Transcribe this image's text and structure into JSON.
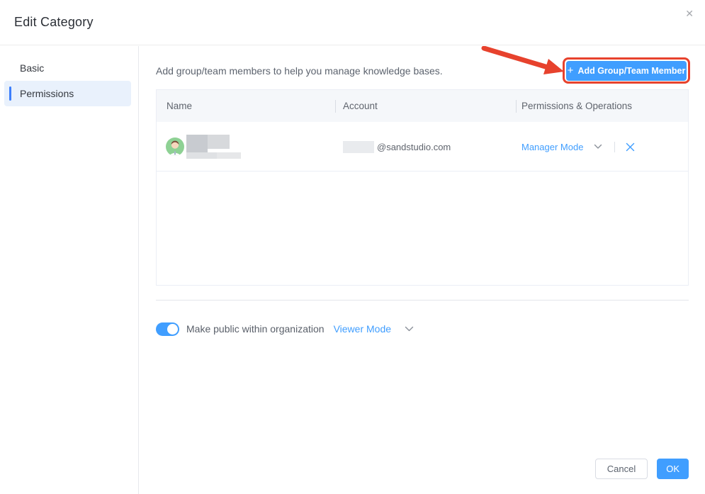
{
  "dialog": {
    "title": "Edit Category"
  },
  "icons": {
    "close": "✕",
    "plus": "+",
    "chevron_down": "v-shape",
    "remove": "x-shape"
  },
  "sidebar": {
    "items": [
      {
        "label": "Basic",
        "active": false
      },
      {
        "label": "Permissions",
        "active": true
      }
    ]
  },
  "permissions_panel": {
    "description": "Add group/team members to help you manage knowledge bases.",
    "add_member_button": "Add Group/Team Member",
    "table": {
      "columns": [
        "Name",
        "Account",
        "Permissions & Operations"
      ],
      "rows": [
        {
          "name_redacted": true,
          "account_prefix_redacted": true,
          "account": "@sandstudio.com",
          "permission_mode": "Manager Mode"
        }
      ]
    },
    "public_toggle": {
      "state": "on",
      "label": "Make public within organization",
      "mode": "Viewer Mode"
    }
  },
  "footer": {
    "cancel": "Cancel",
    "ok": "OK"
  },
  "colors": {
    "primary_blue": "#409eff",
    "annotation_red": "#e7422d",
    "active_item_bg": "#e9f1fc",
    "active_item_bar": "#3d7ffc",
    "table_header_bg": "#f5f7fa",
    "avatar_green": "#8ed194"
  }
}
